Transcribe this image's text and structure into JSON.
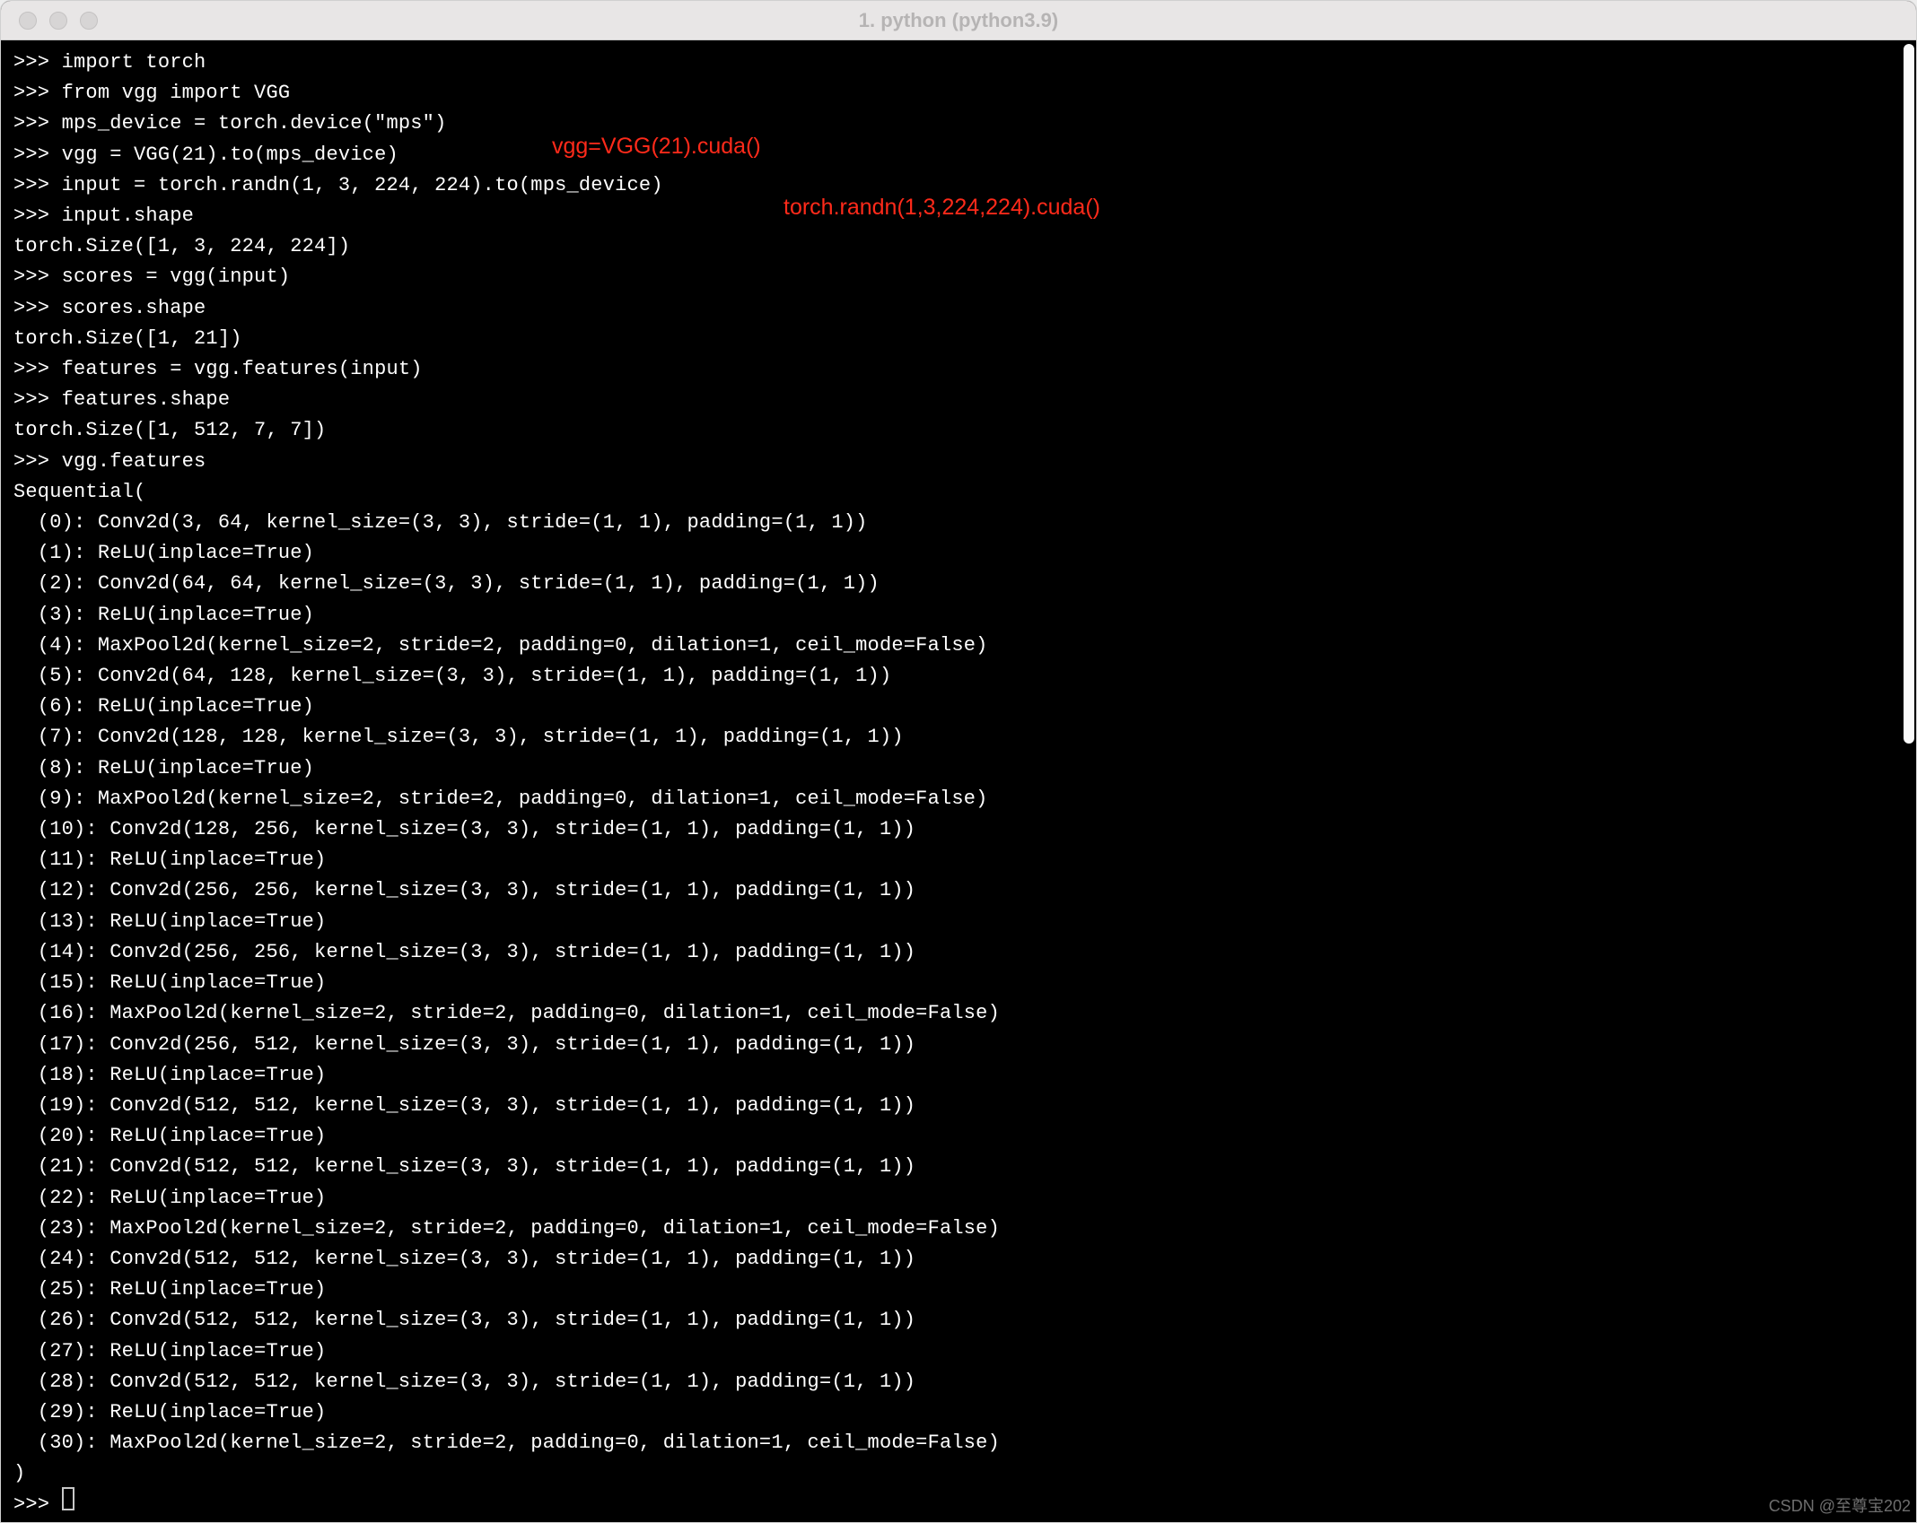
{
  "window": {
    "title": "1. python (python3.9)"
  },
  "annotations": {
    "a1": "vgg=VGG(21).cuda()",
    "a2": "torch.randn(1,3,224,224).cuda()"
  },
  "prompt": ">>> ",
  "lines": [
    {
      "type": "input",
      "text": "import torch"
    },
    {
      "type": "input",
      "text": "from vgg import VGG"
    },
    {
      "type": "input",
      "text": "mps_device = torch.device(\"mps\")"
    },
    {
      "type": "input",
      "text": "vgg = VGG(21).to(mps_device)"
    },
    {
      "type": "input",
      "text": "input = torch.randn(1, 3, 224, 224).to(mps_device)"
    },
    {
      "type": "input",
      "text": "input.shape"
    },
    {
      "type": "output",
      "text": "torch.Size([1, 3, 224, 224])"
    },
    {
      "type": "input",
      "text": "scores = vgg(input)"
    },
    {
      "type": "input",
      "text": "scores.shape"
    },
    {
      "type": "output",
      "text": "torch.Size([1, 21])"
    },
    {
      "type": "input",
      "text": "features = vgg.features(input)"
    },
    {
      "type": "input",
      "text": "features.shape"
    },
    {
      "type": "output",
      "text": "torch.Size([1, 512, 7, 7])"
    },
    {
      "type": "input",
      "text": "vgg.features"
    },
    {
      "type": "output",
      "text": "Sequential("
    },
    {
      "type": "output",
      "text": "  (0): Conv2d(3, 64, kernel_size=(3, 3), stride=(1, 1), padding=(1, 1))"
    },
    {
      "type": "output",
      "text": "  (1): ReLU(inplace=True)"
    },
    {
      "type": "output",
      "text": "  (2): Conv2d(64, 64, kernel_size=(3, 3), stride=(1, 1), padding=(1, 1))"
    },
    {
      "type": "output",
      "text": "  (3): ReLU(inplace=True)"
    },
    {
      "type": "output",
      "text": "  (4): MaxPool2d(kernel_size=2, stride=2, padding=0, dilation=1, ceil_mode=False)"
    },
    {
      "type": "output",
      "text": "  (5): Conv2d(64, 128, kernel_size=(3, 3), stride=(1, 1), padding=(1, 1))"
    },
    {
      "type": "output",
      "text": "  (6): ReLU(inplace=True)"
    },
    {
      "type": "output",
      "text": "  (7): Conv2d(128, 128, kernel_size=(3, 3), stride=(1, 1), padding=(1, 1))"
    },
    {
      "type": "output",
      "text": "  (8): ReLU(inplace=True)"
    },
    {
      "type": "output",
      "text": "  (9): MaxPool2d(kernel_size=2, stride=2, padding=0, dilation=1, ceil_mode=False)"
    },
    {
      "type": "output",
      "text": "  (10): Conv2d(128, 256, kernel_size=(3, 3), stride=(1, 1), padding=(1, 1))"
    },
    {
      "type": "output",
      "text": "  (11): ReLU(inplace=True)"
    },
    {
      "type": "output",
      "text": "  (12): Conv2d(256, 256, kernel_size=(3, 3), stride=(1, 1), padding=(1, 1))"
    },
    {
      "type": "output",
      "text": "  (13): ReLU(inplace=True)"
    },
    {
      "type": "output",
      "text": "  (14): Conv2d(256, 256, kernel_size=(3, 3), stride=(1, 1), padding=(1, 1))"
    },
    {
      "type": "output",
      "text": "  (15): ReLU(inplace=True)"
    },
    {
      "type": "output",
      "text": "  (16): MaxPool2d(kernel_size=2, stride=2, padding=0, dilation=1, ceil_mode=False)"
    },
    {
      "type": "output",
      "text": "  (17): Conv2d(256, 512, kernel_size=(3, 3), stride=(1, 1), padding=(1, 1))"
    },
    {
      "type": "output",
      "text": "  (18): ReLU(inplace=True)"
    },
    {
      "type": "output",
      "text": "  (19): Conv2d(512, 512, kernel_size=(3, 3), stride=(1, 1), padding=(1, 1))"
    },
    {
      "type": "output",
      "text": "  (20): ReLU(inplace=True)"
    },
    {
      "type": "output",
      "text": "  (21): Conv2d(512, 512, kernel_size=(3, 3), stride=(1, 1), padding=(1, 1))"
    },
    {
      "type": "output",
      "text": "  (22): ReLU(inplace=True)"
    },
    {
      "type": "output",
      "text": "  (23): MaxPool2d(kernel_size=2, stride=2, padding=0, dilation=1, ceil_mode=False)"
    },
    {
      "type": "output",
      "text": "  (24): Conv2d(512, 512, kernel_size=(3, 3), stride=(1, 1), padding=(1, 1))"
    },
    {
      "type": "output",
      "text": "  (25): ReLU(inplace=True)"
    },
    {
      "type": "output",
      "text": "  (26): Conv2d(512, 512, kernel_size=(3, 3), stride=(1, 1), padding=(1, 1))"
    },
    {
      "type": "output",
      "text": "  (27): ReLU(inplace=True)"
    },
    {
      "type": "output",
      "text": "  (28): Conv2d(512, 512, kernel_size=(3, 3), stride=(1, 1), padding=(1, 1))"
    },
    {
      "type": "output",
      "text": "  (29): ReLU(inplace=True)"
    },
    {
      "type": "output",
      "text": "  (30): MaxPool2d(kernel_size=2, stride=2, padding=0, dilation=1, ceil_mode=False)"
    },
    {
      "type": "output",
      "text": ")"
    }
  ],
  "watermark": "CSDN @至尊宝202"
}
